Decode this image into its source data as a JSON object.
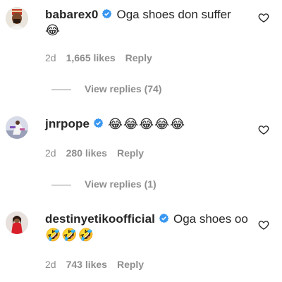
{
  "comments": [
    {
      "username": "babarex0",
      "verified": true,
      "text": "Oga shoes don suffer",
      "emojis": "😂",
      "age": "2d",
      "likes": "1,665 likes",
      "reply_label": "Reply",
      "view_replies": "View replies (74)"
    },
    {
      "username": "jnrpope",
      "verified": true,
      "text": "",
      "emojis": "😂😂😂😂😂",
      "age": "2d",
      "likes": "280 likes",
      "reply_label": "Reply",
      "view_replies": "View replies (1)"
    },
    {
      "username": "destinyetikoofficial",
      "verified": true,
      "text": "Oga shoes oo",
      "emojis": "🤣🤣🤣",
      "age": "2d",
      "likes": "743 likes",
      "reply_label": "Reply"
    }
  ],
  "icons": {
    "verified": "verified-badge-icon",
    "like": "heart-icon"
  },
  "colors": {
    "verified_blue": "#3897f0",
    "meta_gray": "#8e8e8e",
    "text": "#262626"
  }
}
